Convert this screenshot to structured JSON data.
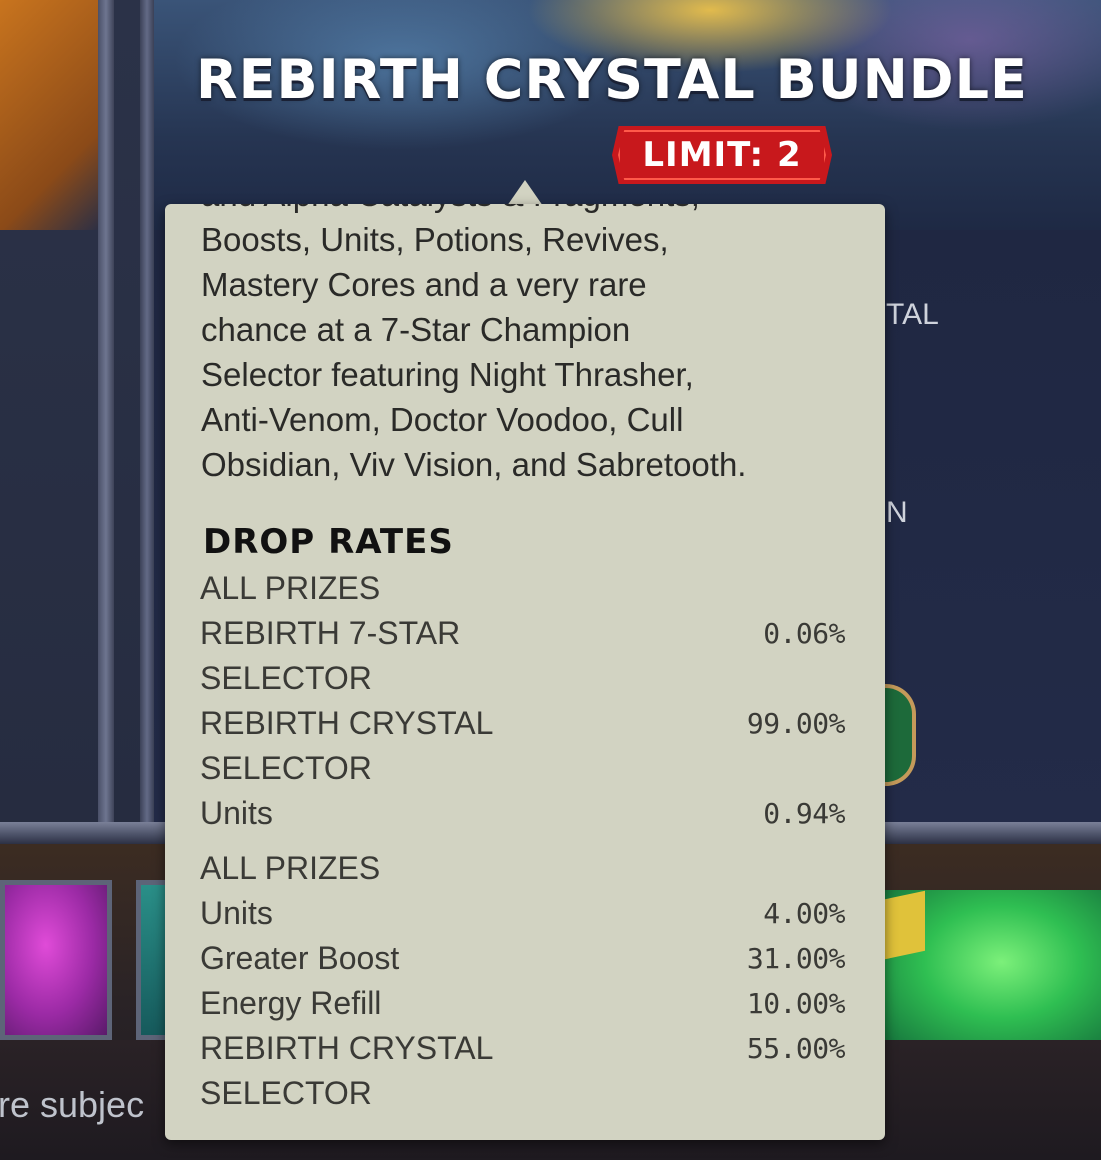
{
  "header": {
    "title": "REBIRTH CRYSTAL BUNDLE",
    "limit": "LIMIT: 2"
  },
  "background": {
    "partial_crystal": "TAL",
    "partial_n": "N",
    "partial_subject": "re subjec"
  },
  "tooltip": {
    "cut_off_line": "and Alpha Catalysts & Fragments,",
    "description_lines": [
      "Boosts, Units, Potions, Revives,",
      "Mastery Cores and a very rare",
      "chance at a 7-Star Champion",
      "Selector featuring Night Thrasher,",
      "Anti-Venom, Doctor Voodoo, Cull",
      "Obsidian, Viv Vision, and Sabretooth."
    ],
    "drop_rates_heading": "DROP RATES",
    "groups": [
      {
        "label": "ALL PRIZES",
        "rows": [
          {
            "name": "REBIRTH 7-STAR SELECTOR",
            "pct": "0.06%"
          },
          {
            "name": "REBIRTH CRYSTAL SELECTOR",
            "pct": "99.00%"
          },
          {
            "name": "Units",
            "pct": "0.94%"
          }
        ]
      },
      {
        "label": "ALL PRIZES",
        "rows": [
          {
            "name": "Units",
            "pct": "4.00%"
          },
          {
            "name": "Greater Boost",
            "pct": "31.00%"
          },
          {
            "name": "Energy Refill",
            "pct": "10.00%"
          },
          {
            "name": "REBIRTH CRYSTAL SELECTOR",
            "pct": "55.00%"
          }
        ]
      }
    ]
  },
  "colors": {
    "tooltip_bg": "#d2d3c2",
    "limit_red": "#c8181c",
    "title_white": "#ffffff"
  }
}
